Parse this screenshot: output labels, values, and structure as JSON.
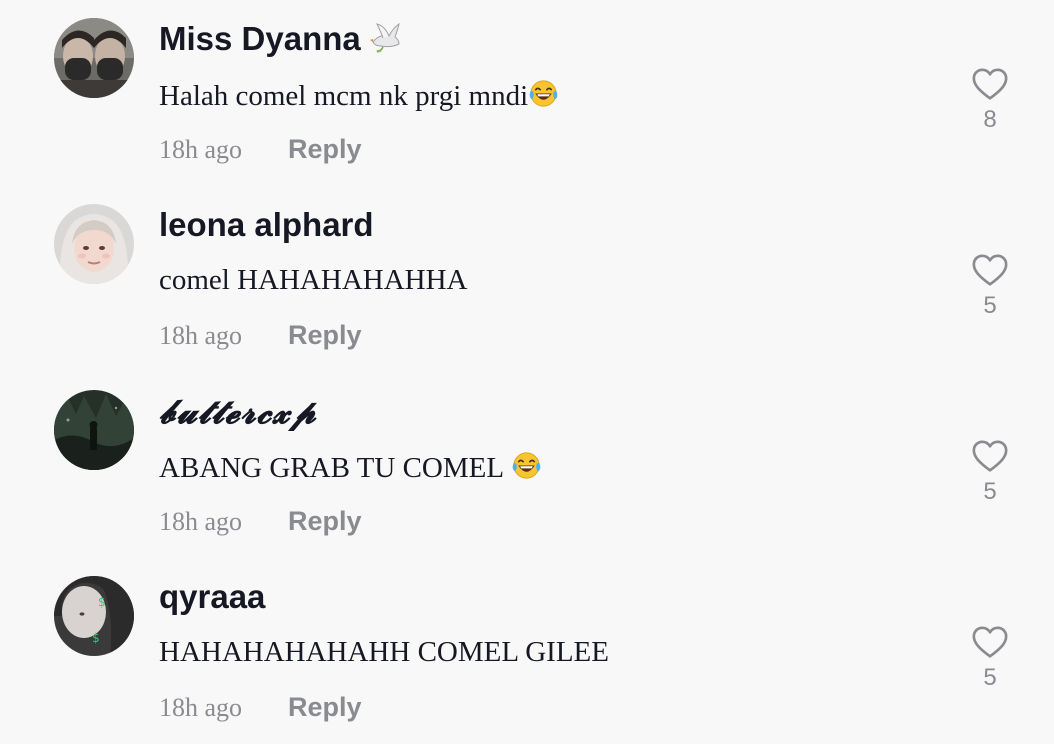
{
  "comments": [
    {
      "username": "Miss Dyanna",
      "username_icon": "dove-icon",
      "text": "Halah comel mcm nk prgi mndi",
      "text_emoji": "tears-of-joy-emoji-icon",
      "time": "18h ago",
      "reply_label": "Reply",
      "likes": "8"
    },
    {
      "username": "leona alphard",
      "text": "comel HAHAHAHAHHA",
      "time": "18h ago",
      "reply_label": "Reply",
      "likes": "5"
    },
    {
      "username": "𝓫𝓾𝓽𝓽𝓮𝓻𝓬𝔁𝓹",
      "text": "ABANG GRAB TU COMEL",
      "text_emoji": "tears-of-joy-emoji-icon",
      "time": "18h ago",
      "reply_label": "Reply",
      "likes": "5"
    },
    {
      "username": "qyraaa",
      "text": "HAHAHAHAHAHH COMEL GILEE",
      "time": "18h ago",
      "reply_label": "Reply",
      "likes": "5"
    }
  ]
}
